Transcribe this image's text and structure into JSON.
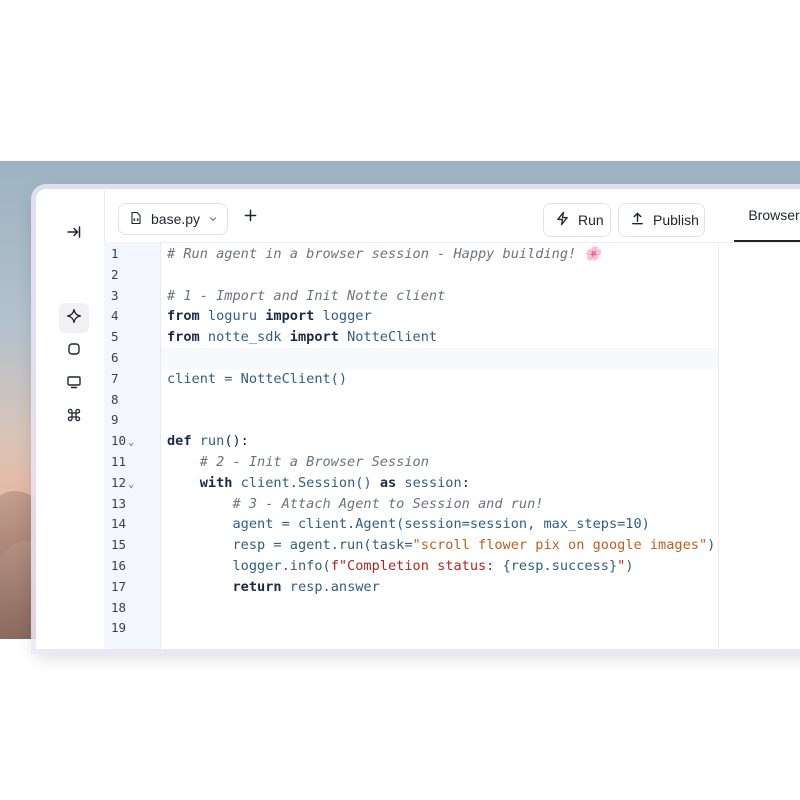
{
  "file_tab": {
    "name": "base.py"
  },
  "toolbar": {
    "run_label": "Run",
    "publish_label": "Publish"
  },
  "panel_tab": {
    "label": "Browser"
  },
  "editor": {
    "current_line": 6,
    "fold_markers": [
      10,
      12
    ],
    "lines": [
      {
        "n": "1",
        "segments": [
          {
            "t": "# Run agent in a browser session - Happy building! 🌸",
            "c": "com"
          }
        ]
      },
      {
        "n": "2",
        "segments": []
      },
      {
        "n": "3",
        "segments": [
          {
            "t": "# 1 - Import and Init Notte client",
            "c": "com"
          }
        ]
      },
      {
        "n": "4",
        "segments": [
          {
            "t": "from",
            "c": "kw"
          },
          {
            "t": " loguru ",
            "c": "id"
          },
          {
            "t": "import",
            "c": "kw"
          },
          {
            "t": " logger",
            "c": "id"
          }
        ]
      },
      {
        "n": "5",
        "segments": [
          {
            "t": "from",
            "c": "kw"
          },
          {
            "t": " notte_sdk ",
            "c": "id"
          },
          {
            "t": "import",
            "c": "kw"
          },
          {
            "t": " NotteClient",
            "c": "id"
          }
        ]
      },
      {
        "n": "6",
        "segments": []
      },
      {
        "n": "7",
        "segments": [
          {
            "t": "client = NotteClient()",
            "c": "id"
          }
        ]
      },
      {
        "n": "8",
        "segments": []
      },
      {
        "n": "9",
        "segments": []
      },
      {
        "n": "10",
        "segments": [
          {
            "t": "def",
            "c": "kw"
          },
          {
            "t": " run",
            "c": "id"
          },
          {
            "t": "():",
            "c": "op"
          }
        ]
      },
      {
        "n": "11",
        "segments": [
          {
            "t": "    # 2 - Init a Browser Session",
            "c": "com"
          }
        ]
      },
      {
        "n": "12",
        "segments": [
          {
            "t": "    ",
            "c": "op"
          },
          {
            "t": "with",
            "c": "kw"
          },
          {
            "t": " client.Session() ",
            "c": "id"
          },
          {
            "t": "as",
            "c": "kw"
          },
          {
            "t": " session",
            "c": "id"
          },
          {
            "t": ":",
            "c": "op"
          }
        ]
      },
      {
        "n": "13",
        "segments": [
          {
            "t": "        # 3 - Attach Agent to Session and run!",
            "c": "com"
          }
        ]
      },
      {
        "n": "14",
        "segments": [
          {
            "t": "        agent = client.Agent(session=session, max_steps=10)",
            "c": "id"
          }
        ]
      },
      {
        "n": "15",
        "segments": [
          {
            "t": "        resp = agent.run(task=",
            "c": "id"
          },
          {
            "t": "\"scroll flower pix on google images\"",
            "c": "str"
          },
          {
            "t": ")",
            "c": "id"
          }
        ]
      },
      {
        "n": "16",
        "segments": [
          {
            "t": "        logger.info(",
            "c": "id"
          },
          {
            "t": "f\"Completion status: ",
            "c": "fstr"
          },
          {
            "t": "{resp.success}",
            "c": "id"
          },
          {
            "t": "\"",
            "c": "fstr"
          },
          {
            "t": ")",
            "c": "id"
          }
        ]
      },
      {
        "n": "17",
        "segments": [
          {
            "t": "        ",
            "c": "op"
          },
          {
            "t": "return",
            "c": "kw"
          },
          {
            "t": " resp.answer",
            "c": "id"
          }
        ]
      },
      {
        "n": "18",
        "segments": []
      },
      {
        "n": "19",
        "segments": []
      }
    ]
  },
  "icons": {
    "collapse": "collapse-sidebar-icon",
    "sparkle": "sparkle-icon",
    "stop": "stop-square-icon",
    "monitor": "monitor-icon",
    "cmd": "command-icon",
    "file": "code-file-icon",
    "chevron": "chevron-down-icon",
    "plus": "plus-icon",
    "bolt": "lightning-bolt-icon",
    "upload": "upload-icon"
  }
}
